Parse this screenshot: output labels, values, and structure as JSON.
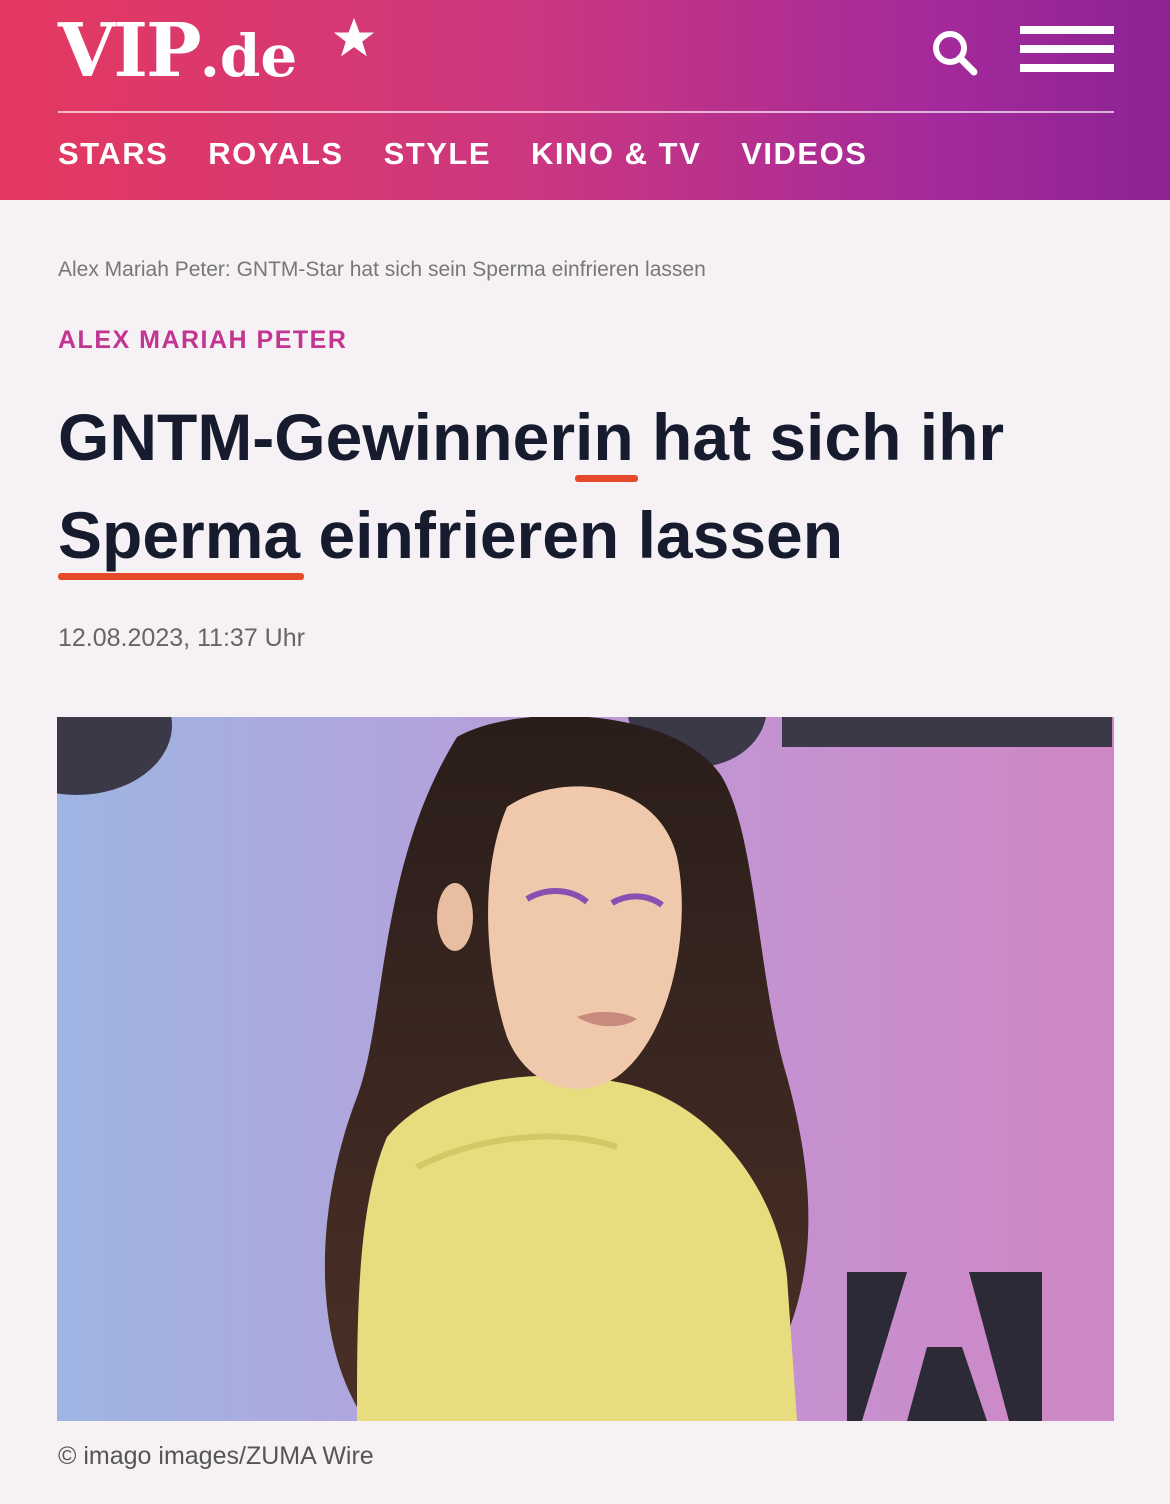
{
  "header": {
    "logo_main": "VIP",
    "logo_suffix": ".de",
    "nav": [
      "STARS",
      "ROYALS",
      "STYLE",
      "KINO & TV",
      "VIDEOS"
    ]
  },
  "icons": {
    "logo_star": "star-icon",
    "search": "search-icon",
    "menu": "hamburger-menu-icon"
  },
  "article": {
    "breadcrumb": "Alex Mariah Peter: GNTM-Star hat sich sein Sperma einfrieren lassen",
    "kicker": "ALEX MARIAH PETER",
    "headline": {
      "part1": "GNTM-Gewinner",
      "part2_underlined": "in",
      "part3": " hat sich ihr ",
      "part4_underlined": "Sperma",
      "part5": " einfrieren lassen"
    },
    "date": "12.08.2023, 11:37 Uhr",
    "image_credit": "© imago images/ZUMA Wire"
  },
  "colors": {
    "header_gradient_start": "#e5395f",
    "header_gradient_end": "#8c2394",
    "kicker": "#c23590",
    "underline": "#e4492a",
    "headline": "#161b2e"
  }
}
